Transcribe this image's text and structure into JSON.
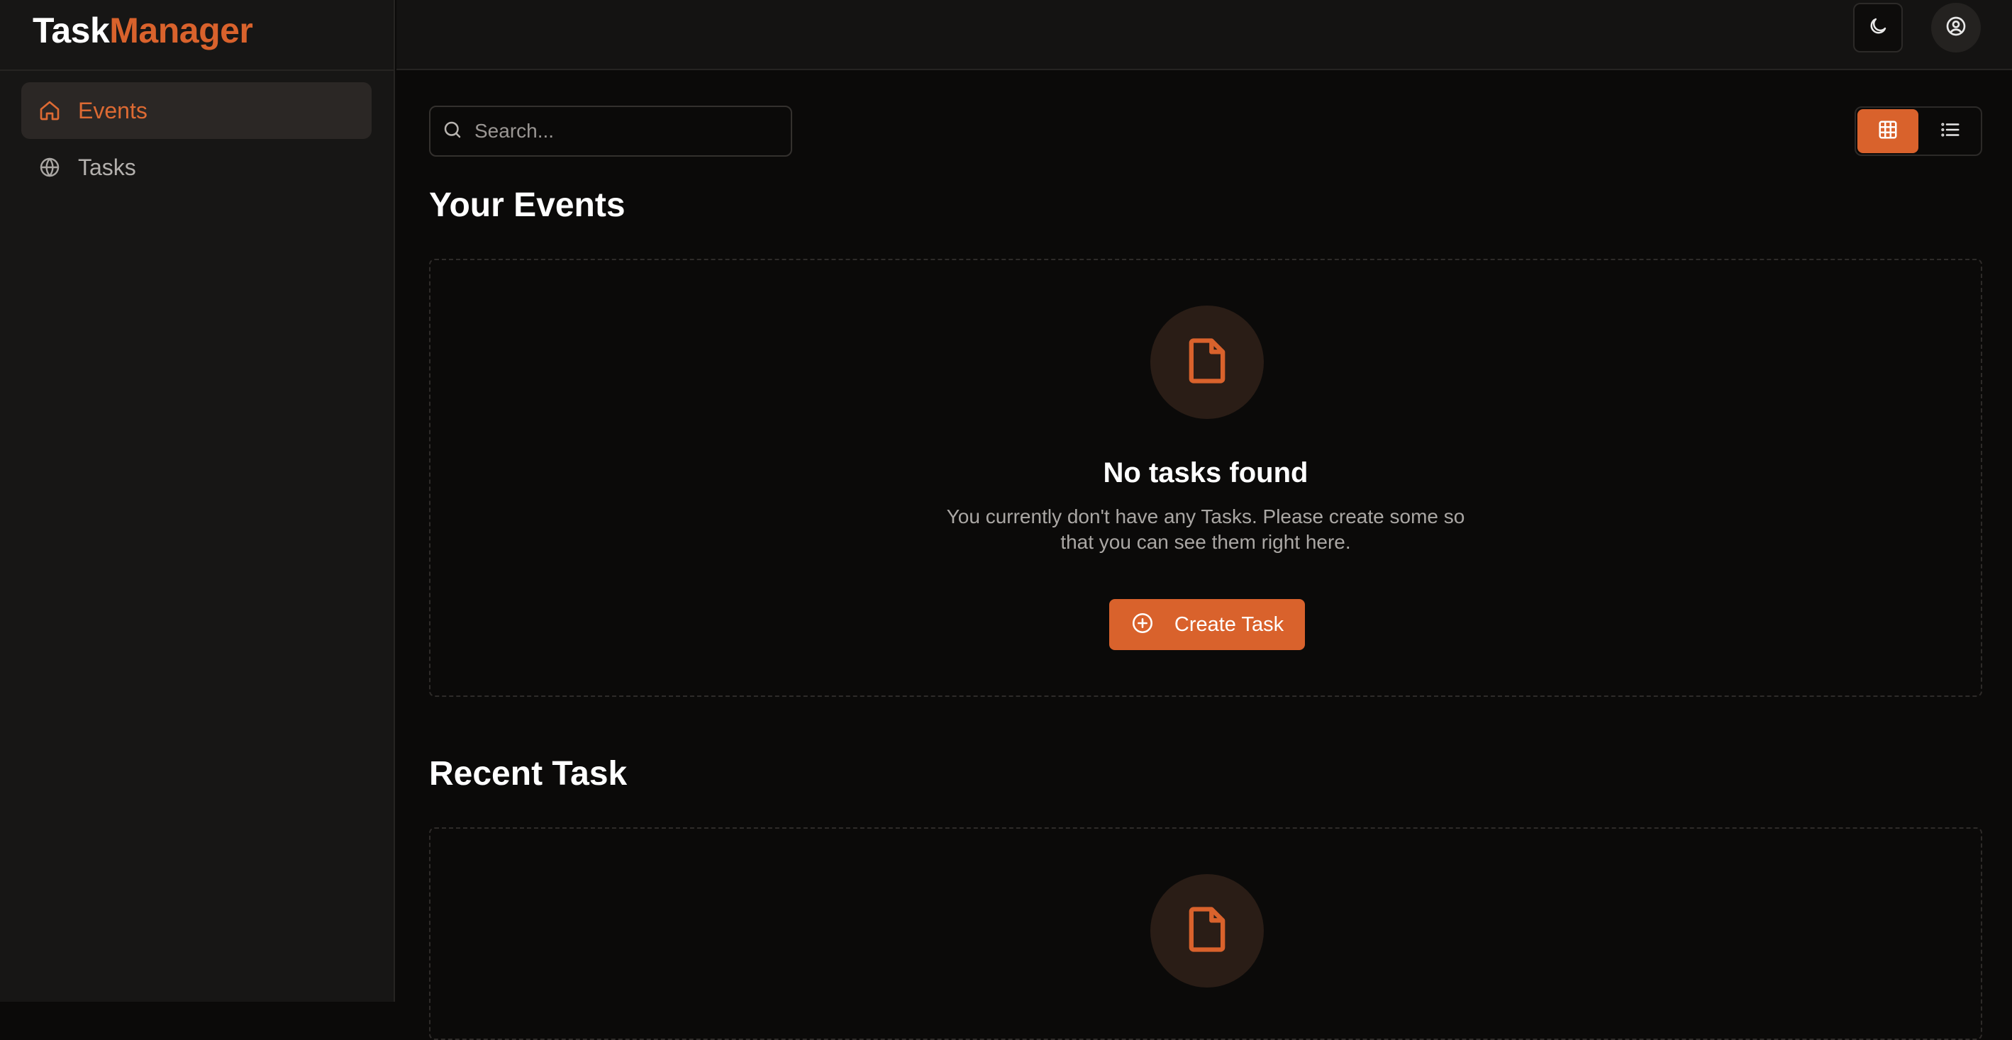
{
  "app": {
    "logo_part1": "Task",
    "logo_part2": "Manager",
    "accent": "#d9622c"
  },
  "sidebar": {
    "items": [
      {
        "label": "Events",
        "icon": "home-icon",
        "active": true
      },
      {
        "label": "Tasks",
        "icon": "globe-icon",
        "active": false
      }
    ]
  },
  "header": {
    "theme_icon": "moon-icon",
    "user_icon": "user-circle-icon"
  },
  "search": {
    "placeholder": "Search..."
  },
  "view_toggle": {
    "options": [
      "grid",
      "list"
    ],
    "selected": "grid"
  },
  "sections": {
    "events": {
      "title": "Your Events",
      "empty_title": "No tasks found",
      "empty_desc": "You currently don't have any Tasks. Please create some so that you can see them right here.",
      "button_label": "Create Task"
    },
    "recent": {
      "title": "Recent Task"
    }
  }
}
